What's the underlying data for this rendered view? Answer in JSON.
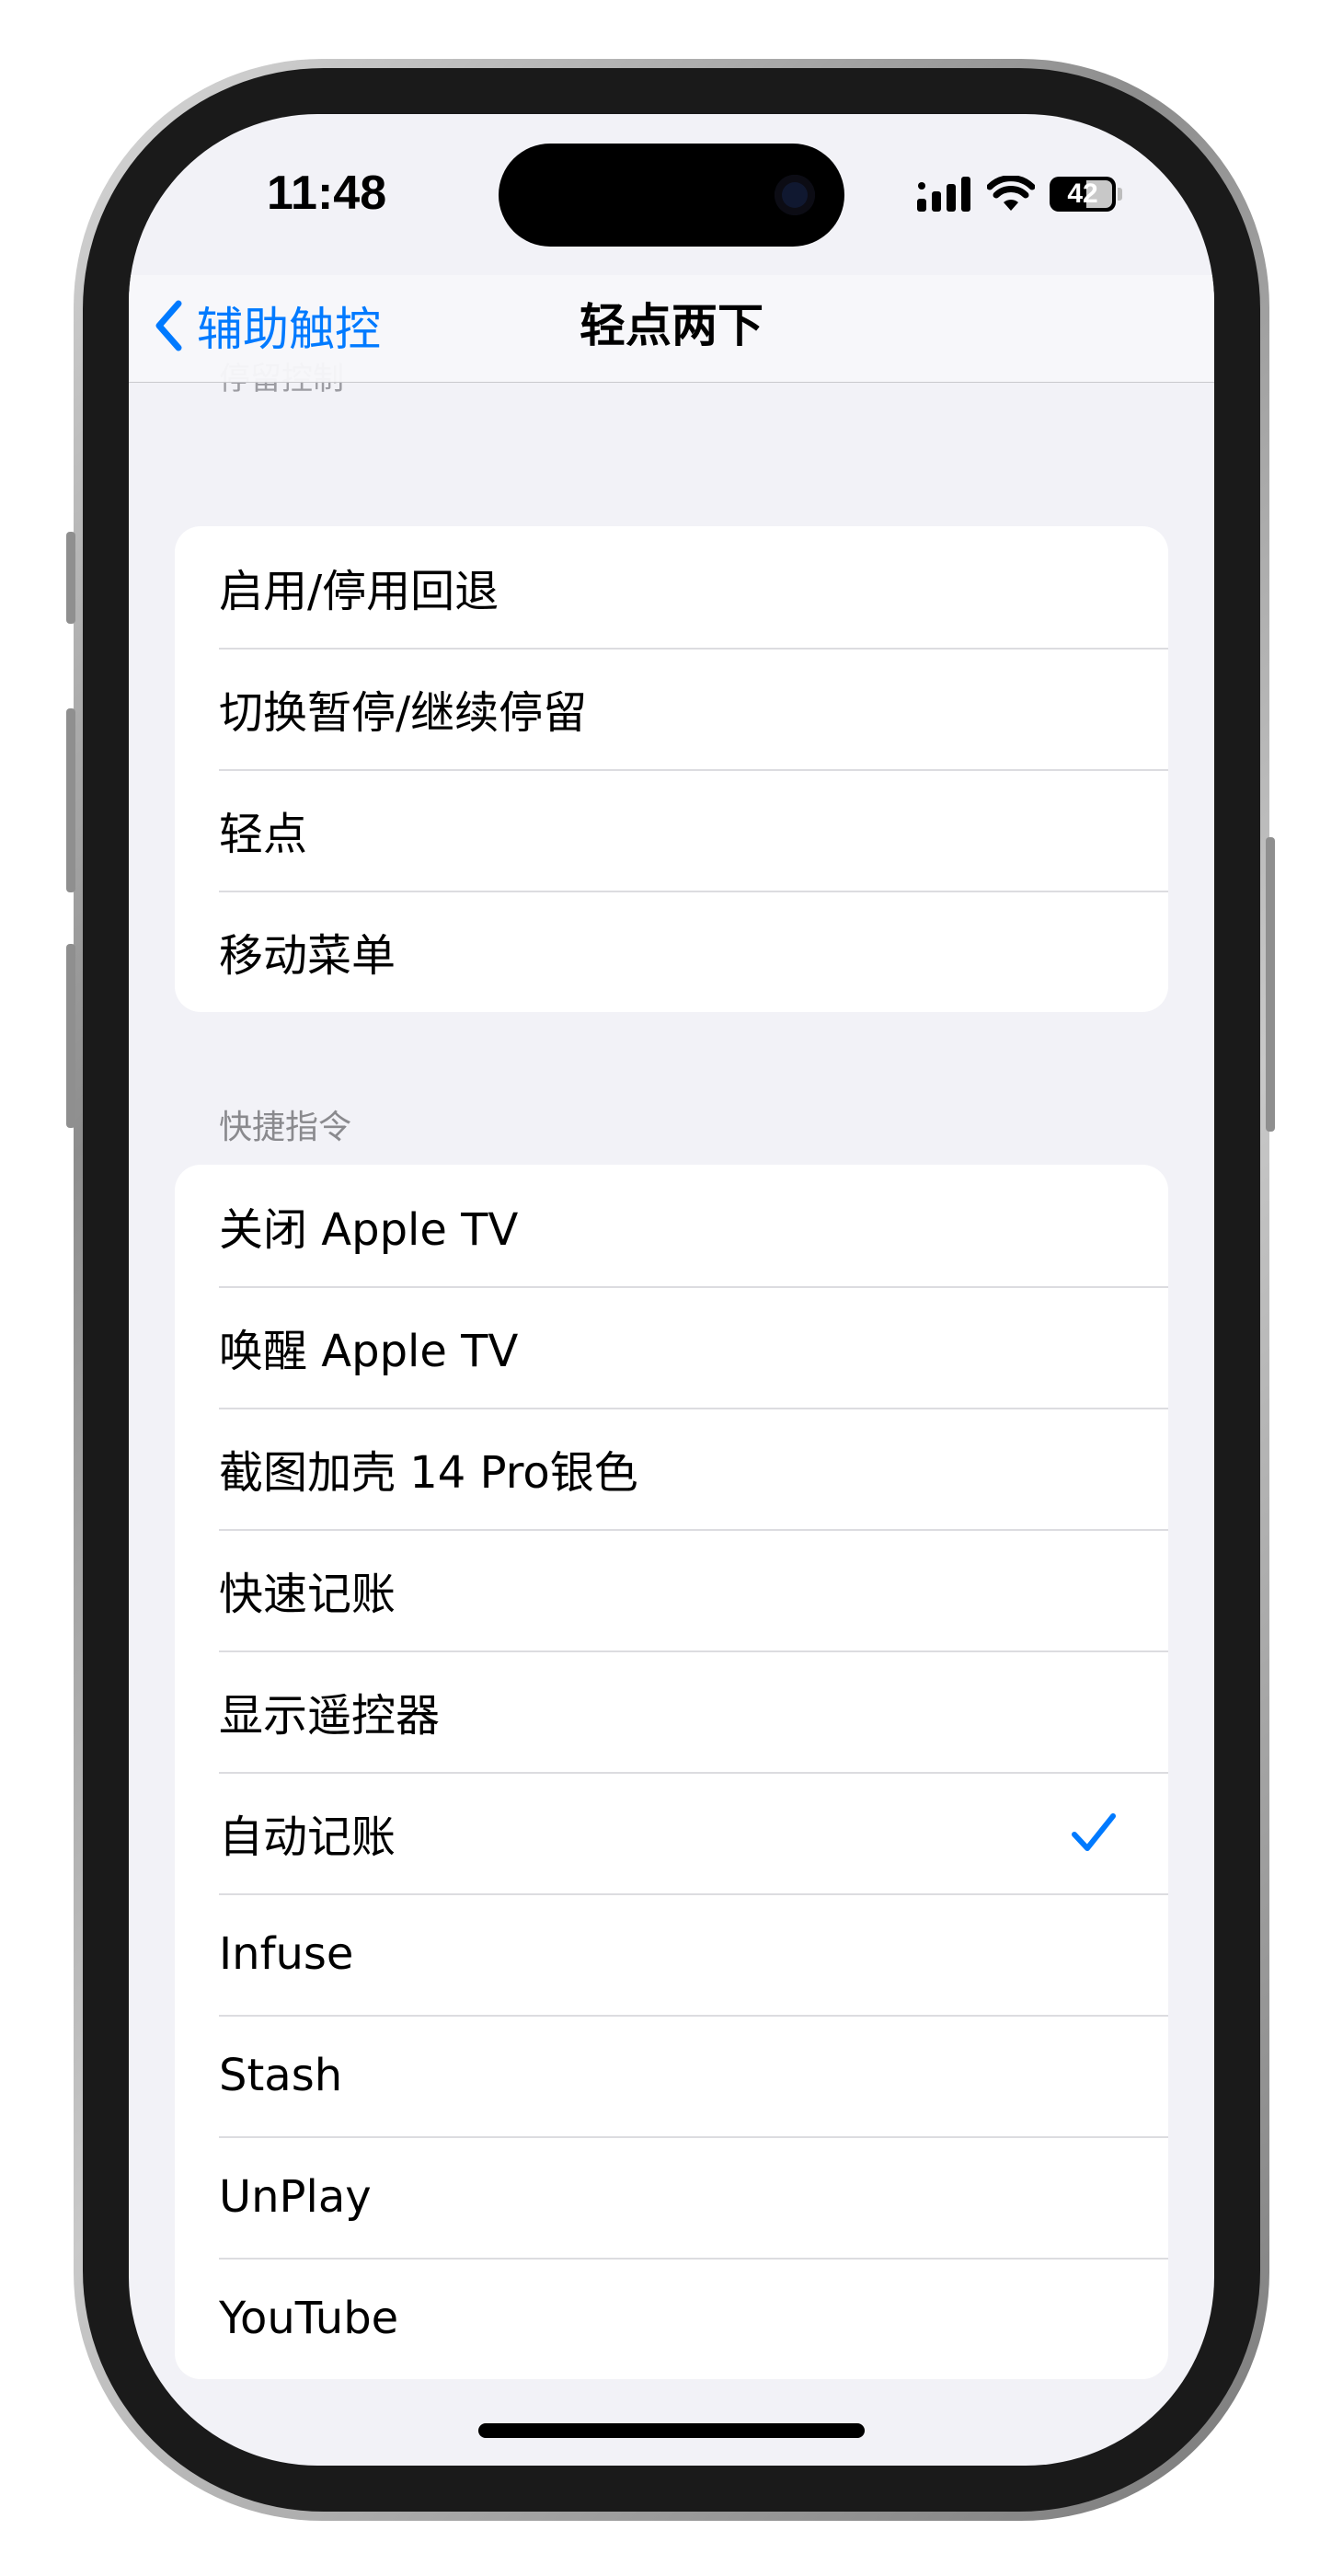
{
  "status_bar": {
    "time": "11:48",
    "battery": "42",
    "icons": [
      "cellular-signal-icon",
      "wifi-icon",
      "battery-icon"
    ]
  },
  "nav": {
    "back_label": "辅助触控",
    "title": "轻点两下"
  },
  "section_top": {
    "header": "停留控制",
    "items": [
      "启用/停用回退",
      "切换暂停/继续停留",
      "轻点",
      "移动菜单"
    ]
  },
  "section_shortcuts": {
    "header": "快捷指令",
    "items": [
      {
        "label": "关闭 Apple TV",
        "checked": false
      },
      {
        "label": "唤醒 Apple TV",
        "checked": false
      },
      {
        "label": "截图加壳 14 Pro银色",
        "checked": false
      },
      {
        "label": "快速记账",
        "checked": false
      },
      {
        "label": "显示遥控器",
        "checked": false
      },
      {
        "label": "自动记账",
        "checked": true
      },
      {
        "label": "Infuse",
        "checked": false
      },
      {
        "label": "Stash",
        "checked": false
      },
      {
        "label": "UnPlay",
        "checked": false
      },
      {
        "label": "YouTube",
        "checked": false
      }
    ]
  },
  "colors": {
    "accent": "#007aff",
    "background": "#f2f2f7",
    "cell": "#ffffff",
    "separator": "#dcdce0",
    "section_header": "#8a8a8e"
  }
}
